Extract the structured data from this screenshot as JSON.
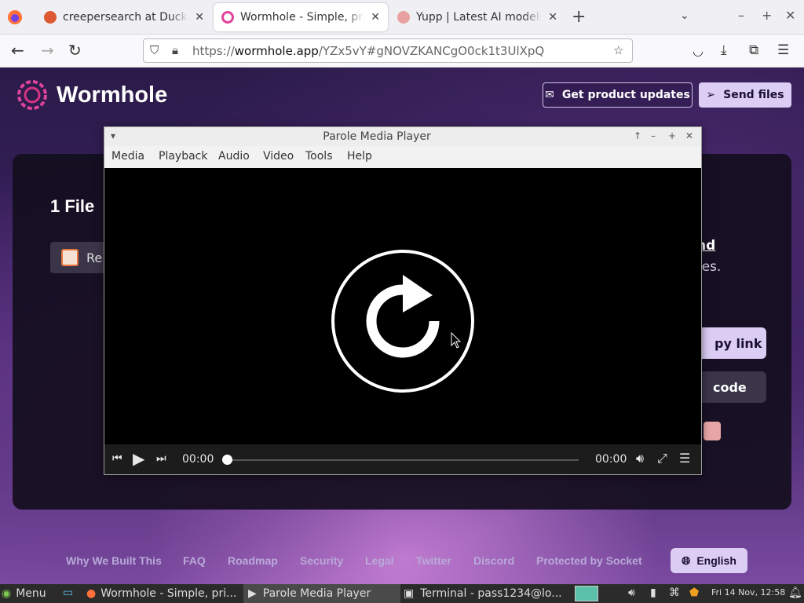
{
  "browser": {
    "tabs": [
      {
        "title": "creepersearch at DuckD",
        "active": false,
        "favicon_color": "#de5833"
      },
      {
        "title": "Wormhole - Simple, priv",
        "active": true,
        "favicon_color": "#e0449a"
      },
      {
        "title": "Yupp | Latest AI models",
        "active": false,
        "favicon_color": "#e8a0a0"
      }
    ],
    "url_prefix": "https://",
    "url_host": "wormhole.app",
    "url_rest": "/YZx5vY#gNOVZKANCgO0ck1t3UlXpQ"
  },
  "page": {
    "brand_name": "Wormhole",
    "updates_label": "Get product updates",
    "send_label": "Send files",
    "file_title": "1 File",
    "file_name_partial": "Re",
    "right_link_partial": "nd",
    "right_text_partial": "res.",
    "copy_link_partial": "py link",
    "qr_partial": "code",
    "footer_links": [
      "Why We Built This",
      "FAQ",
      "Roadmap",
      "Security",
      "Legal",
      "Twitter",
      "Discord",
      "Protected by Socket"
    ],
    "language_label": "English"
  },
  "player": {
    "title": "Parole Media Player",
    "menus": [
      "Media",
      "Playback",
      "Audio",
      "Video",
      "Tools",
      "Help"
    ],
    "elapsed": "00:00",
    "duration": "00:00",
    "progress": 0
  },
  "taskbar": {
    "menu_label": "Menu",
    "windows": [
      {
        "title": "Wormhole - Simple, pri...",
        "active": false
      },
      {
        "title": "Parole Media Player",
        "active": true
      },
      {
        "title": "Terminal - pass1234@lo...",
        "active": false
      }
    ],
    "clock": "Fri 14 Nov, 12:58"
  }
}
